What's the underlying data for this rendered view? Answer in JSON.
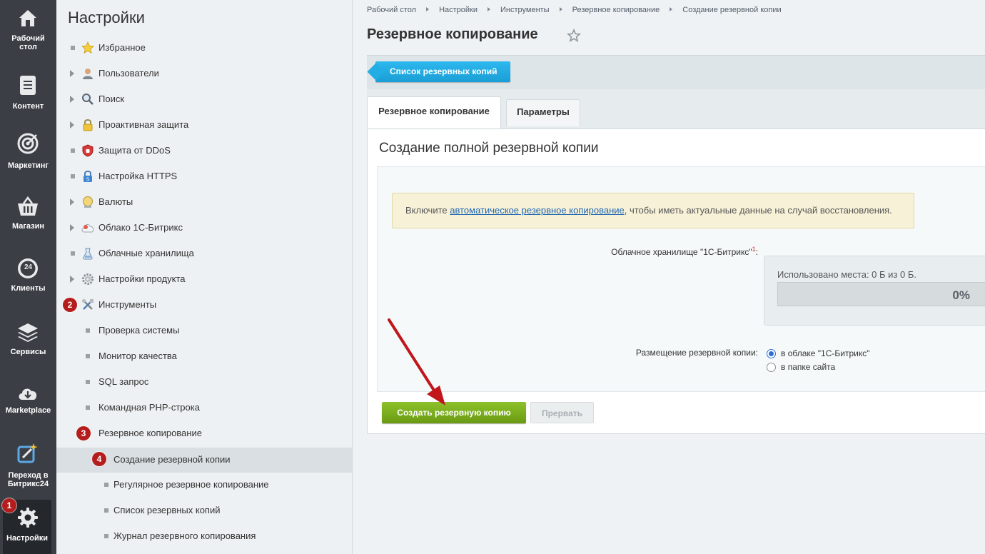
{
  "iconbar": {
    "items": [
      {
        "label": "Рабочий\nстол",
        "l1": "Рабочий",
        "l2": "стол"
      },
      {
        "label": "Контент"
      },
      {
        "label": "Маркетинг"
      },
      {
        "label": "Магазин"
      },
      {
        "label": "Клиенты",
        "icon_text": "24"
      },
      {
        "label": "Сервисы"
      },
      {
        "label": "Marketplace"
      },
      {
        "l1": "Переход в",
        "l2": "Битрикс24"
      },
      {
        "label": "Настройки"
      }
    ]
  },
  "badges": {
    "b1": "1",
    "b2": "2",
    "b3": "3",
    "b4": "4"
  },
  "sidebar": {
    "title": "Настройки",
    "items": [
      {
        "label": "Избранное"
      },
      {
        "label": "Пользователи"
      },
      {
        "label": "Поиск"
      },
      {
        "label": "Проактивная защита"
      },
      {
        "label": "Защита от DDoS"
      },
      {
        "label": "Настройка HTTPS"
      },
      {
        "label": "Валюты"
      },
      {
        "label": "Облако 1С-Битрикс"
      },
      {
        "label": "Облачные хранилища"
      },
      {
        "label": "Настройки продукта"
      },
      {
        "label": "Инструменты"
      },
      {
        "label": "Проверка системы"
      },
      {
        "label": "Монитор качества"
      },
      {
        "label": "SQL запрос"
      },
      {
        "label": "Командная PHP-строка"
      },
      {
        "label": "Резервное копирование"
      },
      {
        "label": "Создание резервной копии"
      },
      {
        "label": "Регулярное резервное копирование"
      },
      {
        "label": "Список резервных копий"
      },
      {
        "label": "Журнал резервного копирования"
      }
    ]
  },
  "breadcrumbs": [
    "Рабочий стол",
    "Настройки",
    "Инструменты",
    "Резервное копирование",
    "Создание резервной копии"
  ],
  "page": {
    "title": "Резервное копирование"
  },
  "toolbar": {
    "list_button": "Список резервных копий"
  },
  "tabs": [
    {
      "label": "Резервное копирование"
    },
    {
      "label": "Параметры"
    }
  ],
  "panel": {
    "title": "Создание полной резервной копии",
    "notice_before": "Включите ",
    "notice_link": "автоматическое резервное копирование",
    "notice_after": ", чтобы иметь актуальные данные на случай восстановления.",
    "cloud_label": "Облачное хранилище \"1С-Битрикс\"",
    "cloud_sup": "1",
    "cloud_colon": ":",
    "usage_text": "Использовано места: 0 Б из 0 Б.",
    "usage_percent": "0%",
    "usage_fraction": 0,
    "placement_label": "Размещение резервной копии:",
    "placement_options": [
      {
        "label": "в облаке \"1С-Битрикс\"",
        "checked": true
      },
      {
        "label": "в папке сайта",
        "checked": false
      }
    ],
    "create_button": "Создать резервную копию",
    "abort_button": "Прервать"
  },
  "colors": {
    "badge": "#b51d1d",
    "primary_green": "#7aad1f",
    "link_blue": "#2067b0",
    "toolbar_blue": "#22aee5",
    "annotation_arrow": "#c0161c"
  }
}
